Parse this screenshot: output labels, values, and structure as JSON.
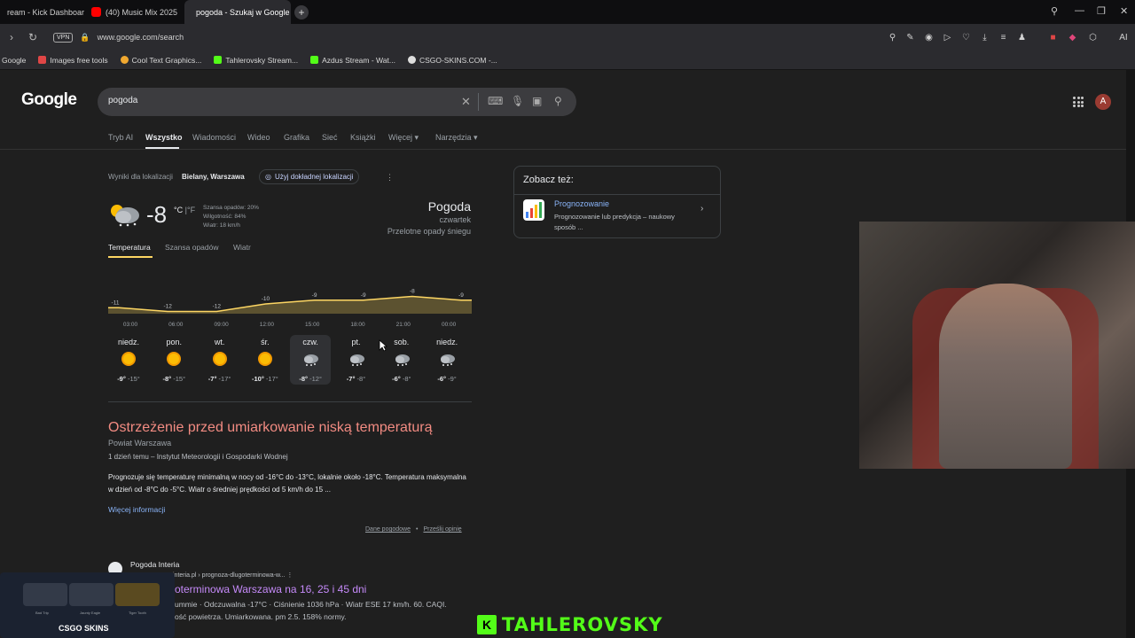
{
  "browser": {
    "tabs": [
      {
        "label": "ream - Kick Dashboard",
        "active": false,
        "favicon_color": "#53fc18"
      },
      {
        "label": "(40) Music Mix 2025",
        "active": false,
        "favicon_color": "#ff0000"
      },
      {
        "label": "pogoda - Szukaj w Google",
        "active": true,
        "favicon_color": "#ffffff"
      }
    ],
    "new_tab": "+",
    "vpn": "VPN",
    "url": "www.google.com/search",
    "ai_label": "AI",
    "bookmarks": [
      {
        "label": "Google",
        "color": "#ffffff"
      },
      {
        "label": "Images free tools",
        "color": "#e04646"
      },
      {
        "label": "Cool Text Graphics...",
        "color": "#f0a830"
      },
      {
        "label": "Tahlerovsky Stream...",
        "color": "#53fc18"
      },
      {
        "label": "Azdus Stream - Wat...",
        "color": "#53fc18"
      },
      {
        "label": "CSGO-SKINS.COM -...",
        "color": "#dddddd"
      }
    ]
  },
  "google": {
    "logo": "Google",
    "query": "pogoda",
    "avatar_letter": "A",
    "nav_tabs": [
      {
        "label": "Tryb AI",
        "active": false
      },
      {
        "label": "Wszystko",
        "active": true
      },
      {
        "label": "Wiadomości",
        "active": false
      },
      {
        "label": "Wideo",
        "active": false
      },
      {
        "label": "Grafika",
        "active": false
      },
      {
        "label": "Sieć",
        "active": false
      },
      {
        "label": "Książki",
        "active": false
      },
      {
        "label": "Więcej",
        "active": false
      },
      {
        "label": "Narzędzia",
        "active": false
      }
    ]
  },
  "weather": {
    "location_prefix": "Wyniki dla lokalizacji",
    "location": "Bielany, Warszawa",
    "precise_button": "Użyj dokładnej lokalizacji",
    "temp": "-8",
    "unit_c": "°C",
    "unit_sep": "|",
    "unit_f": "°F",
    "precip": "Szansa opadów: 20%",
    "humidity": "Wilgotność: 84%",
    "wind": "Wiatr: 18 km/h",
    "title": "Pogoda",
    "day": "czwartek",
    "condition": "Przelotne opady śniegu",
    "tabs": [
      "Temperatura",
      "Szansa opadów",
      "Wiatr"
    ],
    "chart_data": {
      "type": "area",
      "x": [
        "03:00",
        "06:00",
        "09:00",
        "12:00",
        "15:00",
        "18:00",
        "21:00",
        "00:00"
      ],
      "values": [
        -11,
        -12,
        -12,
        -10,
        -9,
        -9,
        -8,
        -9
      ],
      "color": "#fdd663"
    },
    "days": [
      {
        "name": "niedz.",
        "hi": "-9°",
        "lo": "-15°",
        "icon": "sun-icon",
        "selected": false
      },
      {
        "name": "pon.",
        "hi": "-8°",
        "lo": "-15°",
        "icon": "sun-icon",
        "selected": false
      },
      {
        "name": "wt.",
        "hi": "-7°",
        "lo": "-17°",
        "icon": "sun-icon",
        "selected": false
      },
      {
        "name": "śr.",
        "hi": "-10°",
        "lo": "-17°",
        "icon": "sun-icon",
        "selected": false
      },
      {
        "name": "czw.",
        "hi": "-8°",
        "lo": "-12°",
        "icon": "snow-cloud-icon",
        "selected": true
      },
      {
        "name": "pt.",
        "hi": "-7°",
        "lo": "-8°",
        "icon": "snow-cloud-icon",
        "selected": false
      },
      {
        "name": "sob.",
        "hi": "-6°",
        "lo": "-8°",
        "icon": "snow-cloud-icon",
        "selected": false
      },
      {
        "name": "niedz.",
        "hi": "-6°",
        "lo": "-9°",
        "icon": "snow-cloud-icon",
        "selected": false
      }
    ],
    "warning_title": "Ostrzeżenie przed umiarkowanie niską temperaturą",
    "warning_area": "Powiat Warszawa",
    "warning_source": "1 dzień temu – Instytut Meteorologii i Gospodarki Wodnej",
    "warning_text": "Prognozuje się temperaturę minimalną w nocy od -16°C do -13°C, lokalnie około -18°C. Temperatura maksymalna w dzień od -8°C do -5°C. Wiatr o średniej prędkości od 5 km/h do 15 ...",
    "more_info": "Więcej informacji",
    "footer_links": [
      "Dane pogodowe",
      "•",
      "Prześlij opinię"
    ]
  },
  "result": {
    "site": "Pogoda Interia",
    "url": "interia.pl › prognoza-dlugoterminowa-w...",
    "title": "oterminowa Warszawa na 16, 25 i 45 dni",
    "snippet1": "ummie · Odczuwalna -17°C · Ciśnienie 1036 hPa · Wiatr ESE 17 km/h. 60. CAQI.",
    "snippet2": "ość powietrza. Umiarkowana. pm 2.5. 158% normy."
  },
  "see_also": {
    "title": "Zobacz też:",
    "link": "Prognozowanie",
    "desc": "Prognozowanie lub predykcja – naukowy sposób ..."
  },
  "overlay": {
    "csgo_label": "CSGO SKINS",
    "gun_labels": [
      "Bad Trip",
      "Jaunty Eagle",
      "Tiger Tooth"
    ],
    "banner_k": "K",
    "banner_text": "TAHLEROVSKY"
  }
}
